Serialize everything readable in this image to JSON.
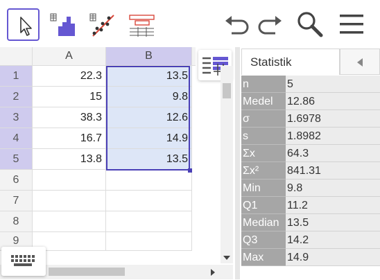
{
  "spreadsheet": {
    "columns": [
      "A",
      "B"
    ],
    "rows": [
      "1",
      "2",
      "3",
      "4",
      "5",
      "6",
      "7",
      "8",
      "9"
    ],
    "colA": [
      "22.3",
      "15",
      "38.3",
      "16.7",
      "13.8"
    ],
    "colB": [
      "13.5",
      "9.8",
      "12.6",
      "14.9",
      "13.5"
    ]
  },
  "stats_panel": {
    "tab": "Statistik",
    "rows": [
      {
        "label": "n",
        "value": "5"
      },
      {
        "label": "Medel",
        "value": "12.86"
      },
      {
        "label": "σ",
        "value": "1.6978"
      },
      {
        "label": "s",
        "value": "1.8982"
      },
      {
        "label": "Σx",
        "value": "64.3"
      },
      {
        "label": "Σx²",
        "value": "841.31"
      },
      {
        "label": "Min",
        "value": "9.8"
      },
      {
        "label": "Q1",
        "value": "11.2"
      },
      {
        "label": "Median",
        "value": "13.5"
      },
      {
        "label": "Q3",
        "value": "14.2"
      },
      {
        "label": "Max",
        "value": "14.9"
      }
    ]
  },
  "icons": {
    "toolbar": [
      "cursor-icon",
      "histogram-icon",
      "regression-icon",
      "boxplot-icon",
      "undo-icon",
      "redo-icon",
      "search-icon",
      "menu-icon"
    ]
  },
  "colors": {
    "accent": "#6557d2",
    "selection": "#dde6f7",
    "header_selected": "#cfcbee",
    "stat_label_bg": "#a6a6a6",
    "stat_value_bg": "#ececec"
  }
}
